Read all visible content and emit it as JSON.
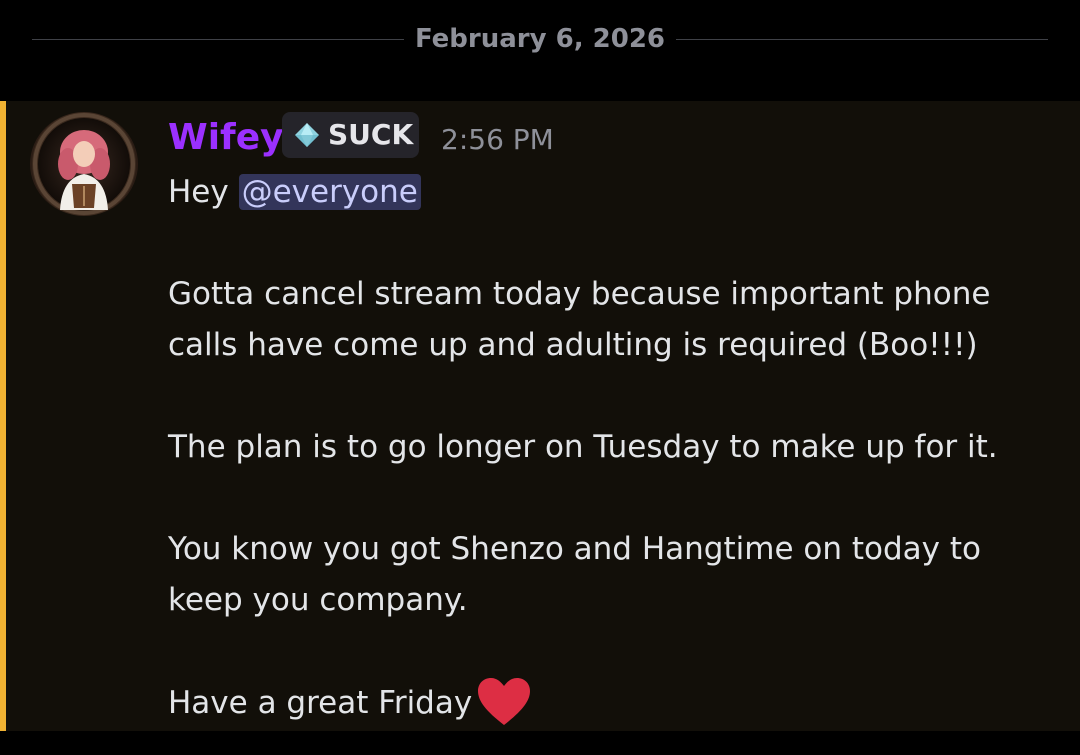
{
  "date_divider": {
    "label": "February 6, 2026"
  },
  "message": {
    "username": "Wifey",
    "username_color": "#9b30ff",
    "tag": {
      "icon": "diamond-gem-icon",
      "label": "SUCK"
    },
    "timestamp": "2:56 PM",
    "mention_bar_color": "#f0b232",
    "lines": {
      "greeting_prefix": "Hey ",
      "mention": "@everyone",
      "paragraph_1": "Gotta cancel stream today because important phone calls have come up and adulting is required (Boo!!!)",
      "paragraph_2": "The plan is to go longer on Tuesday to make up for it.",
      "paragraph_3": "You know you got Shenzo and Hangtime on today to keep you company.",
      "closing": "Have a great Friday",
      "closing_emoji": "heart-icon"
    }
  }
}
